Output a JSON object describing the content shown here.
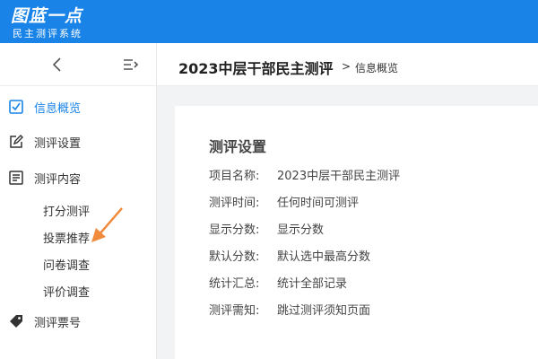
{
  "brand": {
    "logo_text": "图蓝一点",
    "subtitle": "民主测评系统"
  },
  "sidebar": {
    "items": [
      {
        "label": "信息概览",
        "icon": "checkbox-icon",
        "active": true
      },
      {
        "label": "测评设置",
        "icon": "edit-icon"
      },
      {
        "label": "测评内容",
        "icon": "list-icon"
      },
      {
        "label": "测评票号",
        "icon": "tag-icon"
      }
    ],
    "sub_items": [
      {
        "label": "打分测评"
      },
      {
        "label": "投票推荐"
      },
      {
        "label": "问卷调查"
      },
      {
        "label": "评价调查"
      }
    ]
  },
  "header": {
    "title": "2023中层干部民主测评",
    "separator": ">",
    "breadcrumb_current": "信息概览"
  },
  "card": {
    "title": "测评设置",
    "rows": [
      {
        "key": "项目名称:",
        "value": "2023中层干部民主测评"
      },
      {
        "key": "测评时间:",
        "value": "任何时间可测评"
      },
      {
        "key": "显示分数:",
        "value": "显示分数"
      },
      {
        "key": "默认分数:",
        "value": "默认选中最高分数"
      },
      {
        "key": "统计汇总:",
        "value": "统计全部记录"
      },
      {
        "key": "测评需知:",
        "value": "跳过测评须知页面"
      }
    ]
  },
  "colors": {
    "primary": "#1a83e8",
    "arrow": "#f08a3c"
  }
}
